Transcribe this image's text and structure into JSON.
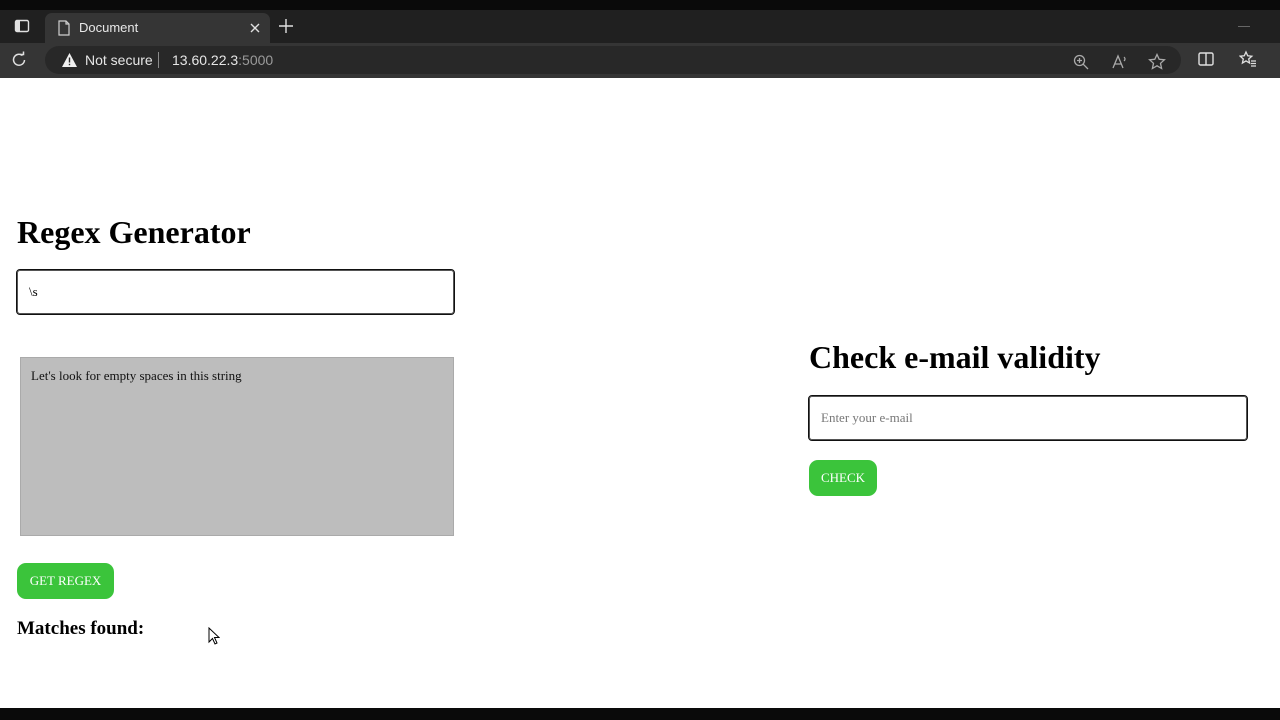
{
  "browser": {
    "tab_title": "Document",
    "security_label": "Not secure",
    "url_host": "13.60.22.3",
    "url_port": ":5000"
  },
  "regex_section": {
    "title": "Regex Generator",
    "pattern_value": "\\s",
    "test_text": "Let's look for empty spaces in this string",
    "button_label": "GET REGEX",
    "matches_label": "Matches found:"
  },
  "email_section": {
    "title": "Check e-mail validity",
    "email_placeholder": "Enter your e-mail",
    "email_value": "",
    "button_label": "CHECK"
  },
  "colors": {
    "button_green": "#3bc43b",
    "textarea_bg": "#bdbdbd",
    "chrome_dark": "#202020"
  },
  "icons": [
    "window-icon",
    "page-icon",
    "close-icon",
    "plus-icon",
    "reload-icon",
    "warning-icon",
    "zoom-icon",
    "read-aloud-icon",
    "favorite-star-icon",
    "split-screen-icon",
    "favorites-icon",
    "mouse-cursor-icon"
  ]
}
